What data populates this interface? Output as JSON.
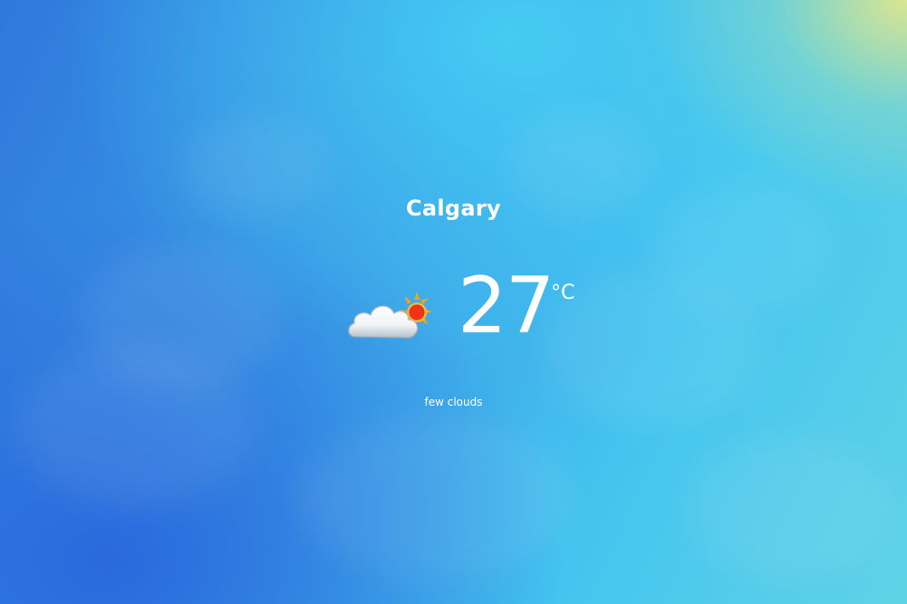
{
  "weather": {
    "city": "Calgary",
    "temperature": "27",
    "unit": "°C",
    "description": "few clouds",
    "icon": "cloud-sun-icon"
  },
  "colors": {
    "background_start": "#2f78dc",
    "background_mid": "#44c4ef",
    "background_corner": "#e2e68c",
    "text": "#ffffff",
    "sun": "#f7a21b",
    "sun_core": "#e8381e"
  }
}
